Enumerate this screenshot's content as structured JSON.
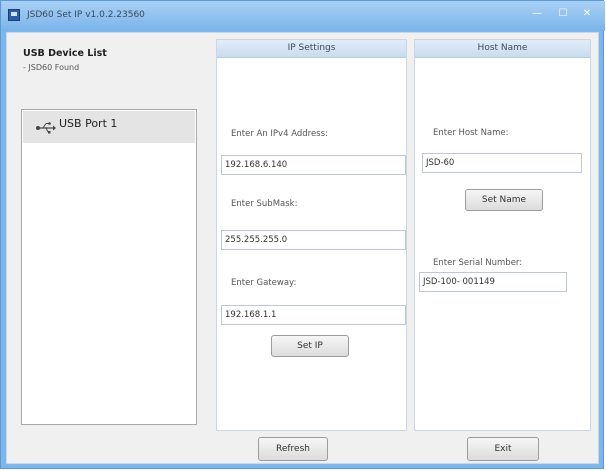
{
  "window": {
    "title": "JSD60 Set IP v1.0.2.23560",
    "controls": {
      "minimize": "—",
      "maximize": "☐",
      "close": "✕"
    }
  },
  "usb_device_list": {
    "title": "USB Device List",
    "status": "- JSD60 Found",
    "items": [
      {
        "label": "USB Port 1",
        "icon": "usb-icon"
      }
    ]
  },
  "ip_settings": {
    "header": "IP Settings",
    "ipv4_label": "Enter An IPv4 Address:",
    "ipv4_value": "192.168.6.140",
    "subnet_label": "Enter SubMask:",
    "subnet_value": "255.255.255.0",
    "gateway_label": "Enter Gateway:",
    "gateway_value": "192.168.1.1",
    "set_ip_button": "Set IP"
  },
  "host_name": {
    "header": "Host Name",
    "host_label": "Enter Host Name:",
    "host_value": "JSD-60",
    "set_name_button": "Set Name",
    "serial_label": "Enter Serial Number:",
    "serial_value": "JSD-100- 001149"
  },
  "footer": {
    "refresh_button": "Refresh",
    "exit_button": "Exit"
  }
}
